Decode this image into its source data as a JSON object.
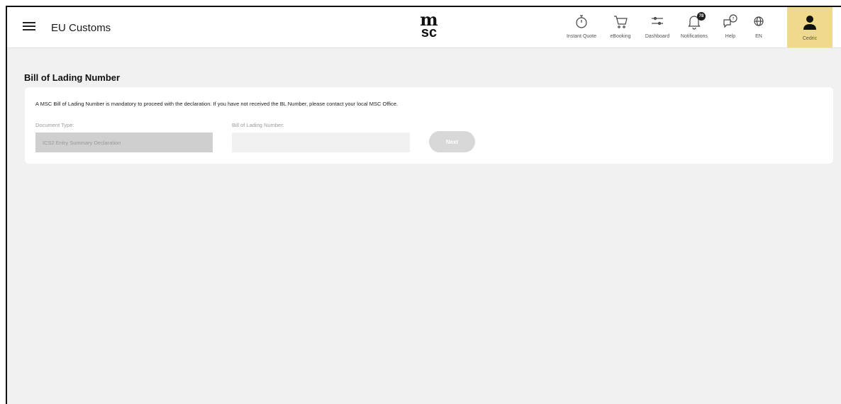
{
  "header": {
    "app_title": "EU Customs",
    "logo_line1": "m",
    "logo_line2": "sc",
    "nav": [
      {
        "label": "Instant Quote",
        "icon": "stopwatch-icon"
      },
      {
        "label": "eBooking",
        "icon": "cart-icon"
      },
      {
        "label": "Dashboard",
        "icon": "sliders-icon"
      },
      {
        "label": "Notifications",
        "icon": "bell-icon",
        "badge": "78"
      },
      {
        "label": "Help",
        "icon": "help-chat-icon"
      },
      {
        "label": "EN",
        "icon": "globe-icon"
      }
    ],
    "user": {
      "label": "Cedric",
      "icon": "user-icon",
      "bg": "#eed98d"
    }
  },
  "main": {
    "heading": "Bill of Lading Number",
    "notice": "A MSC Bill of Lading Number is mandatory to proceed with the declaration. If you have not received the BL Number, please contact your local MSC Office.",
    "document_type_label": "Document Type:",
    "document_type_value": "ICS2 Entry Summary Declaration",
    "bl_label": "Bill of Lading Number:",
    "bl_value": "",
    "bl_placeholder": "",
    "next_label": "Next"
  }
}
